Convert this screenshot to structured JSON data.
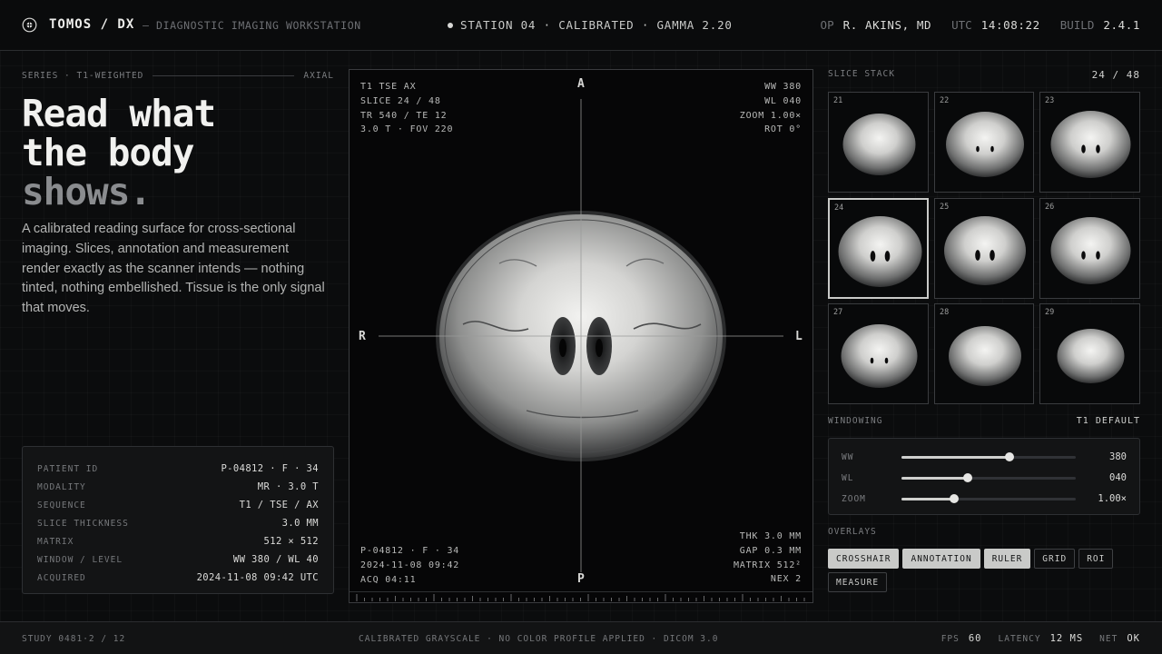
{
  "header": {
    "brand": "TOMOS / DX",
    "tagline": "— DIAGNOSTIC IMAGING WORKSTATION",
    "station": "STATION 04 · CALIBRATED · GAMMA 2.20",
    "op_label": "OP",
    "op_value": "R. AKINS, MD",
    "utc_label": "UTC",
    "utc_value": "14:08:22",
    "build_label": "BUILD",
    "build_value": "2.4.1"
  },
  "series": {
    "label": "SERIES · T1-WEIGHTED",
    "plane": "AXIAL"
  },
  "hero": {
    "line1": "Read what",
    "line2": "the body",
    "line3": "shows."
  },
  "description": "A calibrated reading surface for cross-sectional imaging. Slices, annotation and measurement render exactly as the scanner intends — nothing tinted, nothing embellished. Tissue is the only signal that moves.",
  "patient": {
    "rows": [
      {
        "key": "PATIENT ID",
        "value": "P-04812 · F · 34"
      },
      {
        "key": "MODALITY",
        "value": "MR · 3.0 T"
      },
      {
        "key": "SEQUENCE",
        "value": "T1 / TSE / AX"
      },
      {
        "key": "SLICE THICKNESS",
        "value": "3.0 MM"
      },
      {
        "key": "MATRIX",
        "value": "512 × 512"
      },
      {
        "key": "WINDOW / LEVEL",
        "value": "WW 380 / WL 40"
      },
      {
        "key": "ACQUIRED",
        "value": "2024-11-08 09:42 UTC"
      }
    ]
  },
  "viewport": {
    "top_left": [
      "T1 TSE AX",
      "SLICE 24 / 48",
      "TR 540 / TE 12",
      "3.0 T · FOV 220"
    ],
    "top_right": [
      "WW 380",
      "WL 040",
      "ZOOM 1.00×",
      "ROT 0°"
    ],
    "bottom_left": [
      "P-04812 · F · 34",
      "2024-11-08 09:42",
      "ACQ 04:11"
    ],
    "bottom_right": [
      "THK 3.0 MM",
      "GAP 0.3 MM",
      "MATRIX 512²",
      "NEX 2"
    ],
    "orient_top": "A",
    "orient_bottom": "P",
    "orient_left": "R",
    "orient_right": "L"
  },
  "stack": {
    "label": "SLICE STACK",
    "count": "24 / 48",
    "selected": "24",
    "slices": [
      "21",
      "22",
      "23",
      "24",
      "25",
      "26",
      "27",
      "28",
      "29"
    ]
  },
  "windowing": {
    "label": "WINDOWING",
    "preset": "T1 DEFAULT",
    "sliders": [
      {
        "label": "WW",
        "value": "380",
        "fraction": 0.62
      },
      {
        "label": "WL",
        "value": "040",
        "fraction": 0.38
      },
      {
        "label": "ZOOM",
        "value": "1.00×",
        "fraction": 0.3
      }
    ]
  },
  "overlays": {
    "label": "OVERLAYS",
    "chips": [
      {
        "label": "CROSSHAIR",
        "active": true
      },
      {
        "label": "ANNOTATION",
        "active": true
      },
      {
        "label": "RULER",
        "active": true
      },
      {
        "label": "GRID",
        "active": false
      },
      {
        "label": "ROI",
        "active": false
      },
      {
        "label": "MEASURE",
        "active": false
      }
    ]
  },
  "footer": {
    "study": "STUDY 0481·2 / 12",
    "center": "CALIBRATED GRAYSCALE · NO COLOR PROFILE APPLIED · DICOM 3.0",
    "fps_label": "FPS",
    "fps_value": "60",
    "latency_label": "LATENCY",
    "latency_value": "12 MS",
    "net_label": "NET",
    "net_value": "OK"
  },
  "colors": {
    "background": "#0b0c0d",
    "panel": "#131415",
    "text": "#dcdcda",
    "muted": "#76787b",
    "accent": "#c9cac8"
  }
}
